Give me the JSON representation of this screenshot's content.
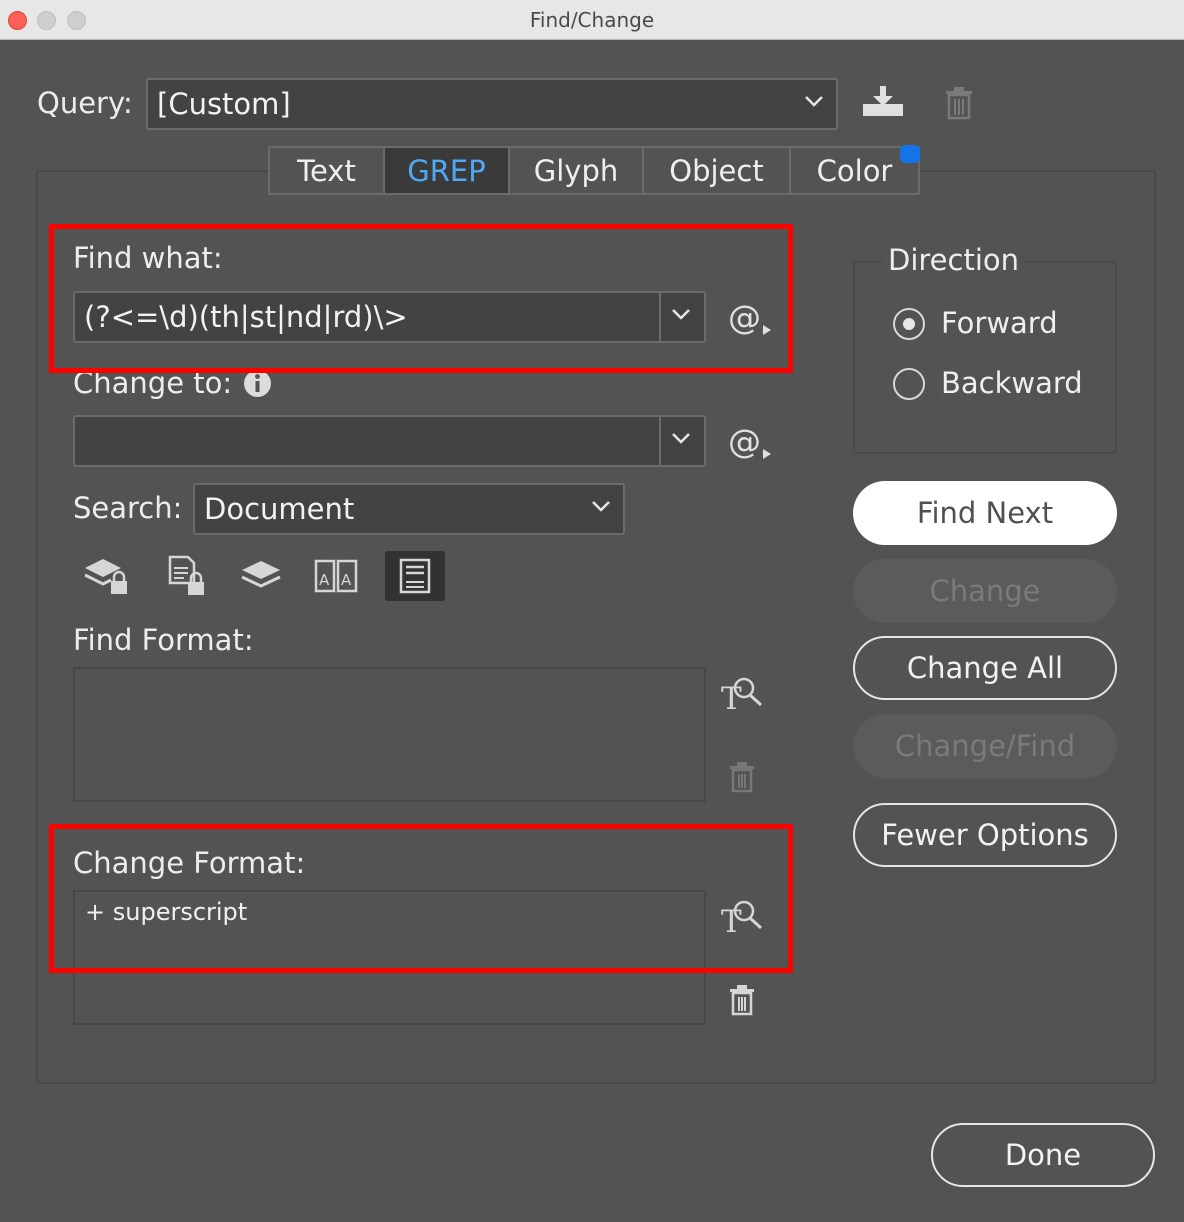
{
  "window": {
    "title": "Find/Change"
  },
  "query": {
    "label": "Query:",
    "value": "[Custom]"
  },
  "tabs": [
    {
      "label": "Text"
    },
    {
      "label": "GREP"
    },
    {
      "label": "Glyph"
    },
    {
      "label": "Object"
    },
    {
      "label": "Color"
    }
  ],
  "active_tab": "GREP",
  "find_what": {
    "label": "Find what:",
    "value": "(?<=\\d)(th|st|nd|rd)\\>"
  },
  "change_to": {
    "label": "Change to:",
    "value": ""
  },
  "search": {
    "label": "Search:",
    "value": "Document"
  },
  "find_format": {
    "label": "Find Format:",
    "value": ""
  },
  "change_format": {
    "label": "Change Format:",
    "value": "+ superscript"
  },
  "direction": {
    "title": "Direction",
    "options": [
      {
        "label": "Forward",
        "checked": true
      },
      {
        "label": "Backward",
        "checked": false
      }
    ]
  },
  "buttons": {
    "find_next": "Find Next",
    "change": "Change",
    "change_all": "Change All",
    "change_find": "Change/Find",
    "fewer_options": "Fewer Options",
    "done": "Done"
  },
  "icons": {
    "save_query": "save-query-icon",
    "delete_query": "trash-icon",
    "special_chars": "at-sign-icon",
    "info": "info-icon",
    "locked_layers": "locked-layers-icon",
    "locked_stories": "locked-stories-icon",
    "hidden_layers": "hidden-layers-icon",
    "master_pages": "master-pages-icon",
    "footnotes": "footnotes-icon",
    "specify_format": "format-search-icon"
  },
  "colors": {
    "accent": "#4fa9f5",
    "highlight_box": "#ff0000",
    "badge": "#1473e6",
    "background": "#535353"
  }
}
